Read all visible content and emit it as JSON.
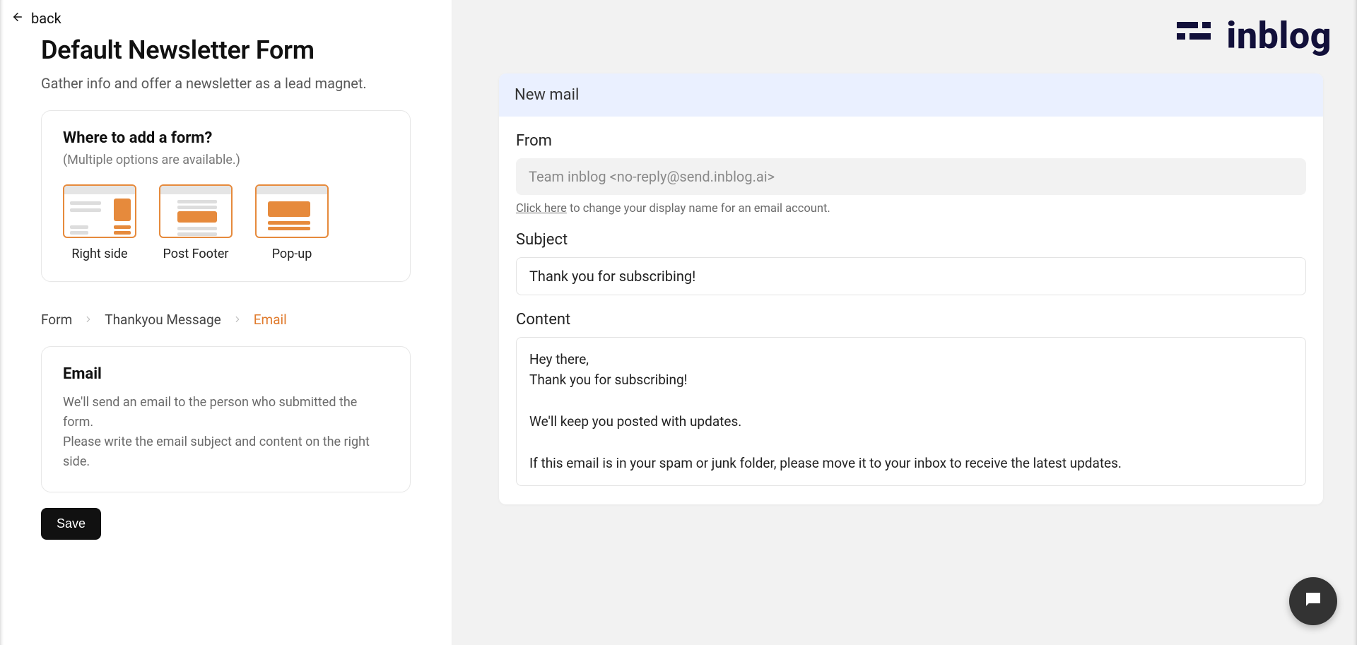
{
  "nav": {
    "back_label": "back"
  },
  "page": {
    "title": "Default Newsletter Form",
    "subtitle": "Gather info and offer a newsletter as a lead magnet."
  },
  "placement": {
    "title": "Where to add a form?",
    "note": "(Multiple options are available.)",
    "options": [
      {
        "label": "Right side"
      },
      {
        "label": "Post Footer"
      },
      {
        "label": "Pop-up"
      }
    ]
  },
  "steps": {
    "items": [
      {
        "label": "Form",
        "active": false
      },
      {
        "label": "Thankyou Message",
        "active": false
      },
      {
        "label": "Email",
        "active": true
      }
    ]
  },
  "email_card": {
    "title": "Email",
    "desc_line1": "We'll send an email to the person who submitted the form.",
    "desc_line2": "Please write the email subject and content on the right side."
  },
  "actions": {
    "save_label": "Save"
  },
  "brand": {
    "name": "inblog"
  },
  "mail": {
    "panel_title": "New mail",
    "from_label": "From",
    "from_value": "Team inblog <no-reply@send.inblog.ai>",
    "from_hint_link": "Click here",
    "from_hint_rest": " to change your display name for an email account.",
    "subject_label": "Subject",
    "subject_value": "Thank you for subscribing!",
    "content_label": "Content",
    "content_value": "Hey there,\nThank you for subscribing!\n\nWe'll keep you posted with updates.\n\nIf this email is in your spam or junk folder, please move it to your inbox to receive the latest updates."
  }
}
